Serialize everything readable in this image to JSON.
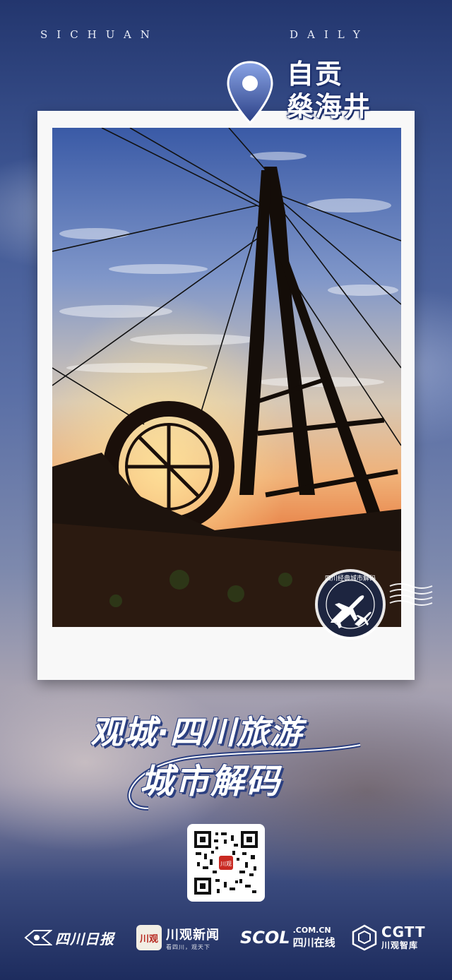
{
  "masthead": {
    "left": "SICHUAN",
    "right": "DAILY"
  },
  "location": {
    "city": "自贡",
    "site": "燊海井",
    "icon": "location-pin-icon"
  },
  "stamp": {
    "ring_text": "四川经典城市解码",
    "icon": "airplane-icon"
  },
  "brand": {
    "line1": "观城·四川旅游",
    "line2": "城市解码"
  },
  "qr": {
    "center_label": "川观"
  },
  "footer": {
    "logo1": {
      "icon": "sichuan-daily-emblem-icon",
      "text": "四川日报"
    },
    "logo2": {
      "badge": "川观",
      "text": "川观新闻",
      "sub": "看四川，观天下"
    },
    "logo3": {
      "mark": "SCOL",
      "domain": ".COM.CN",
      "text": "四川在线"
    },
    "logo4": {
      "icon": "cgtt-cube-icon",
      "mark": "CGTT",
      "text": "川观智库"
    }
  },
  "colors": {
    "navy": "#1d2f6b",
    "accent_blue": "#2b3f80",
    "badge_red": "#b7281f"
  }
}
